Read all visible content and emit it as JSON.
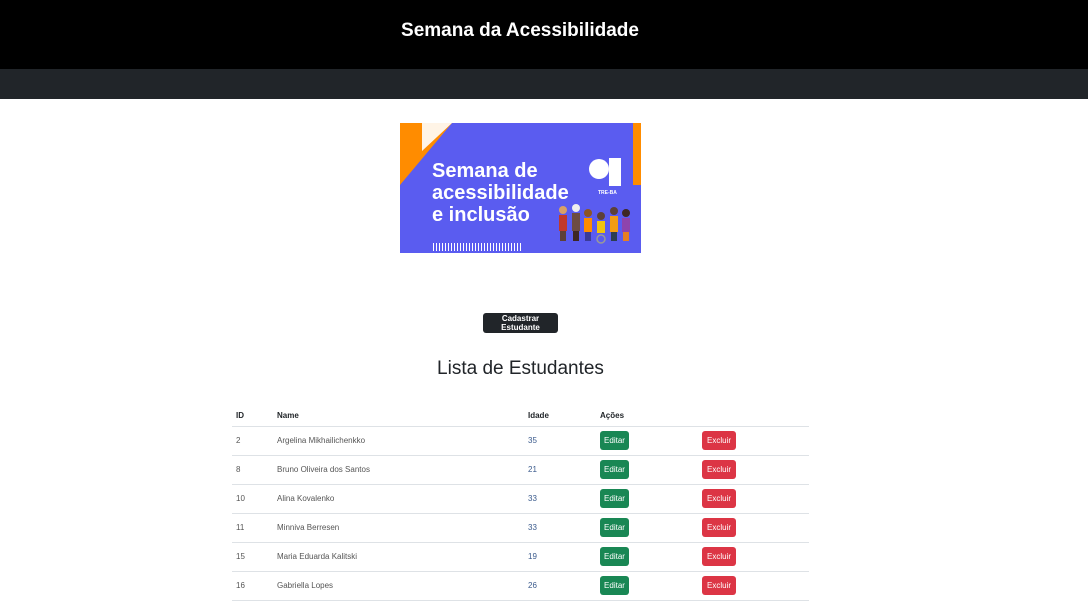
{
  "header": {
    "title": "Semana da Acessibilidade"
  },
  "banner": {
    "line1": "Semana de",
    "line2": "acessibilidade",
    "line3": "e inclusão",
    "logo_text": "TRE-BA",
    "colors": {
      "bg": "#5a5cf0",
      "accent": "#ff8c00"
    }
  },
  "actions": {
    "register_label": "Cadastrar Estudante"
  },
  "list": {
    "title": "Lista de Estudantes",
    "columns": {
      "id": "ID",
      "name": "Name",
      "age": "Idade",
      "actions": "Ações"
    },
    "edit_label": "Editar",
    "delete_label": "Excluir",
    "rows": [
      {
        "id": "2",
        "name": "Argelina Mikhailichenkko",
        "age": "35"
      },
      {
        "id": "8",
        "name": "Bruno Oliveira dos Santos",
        "age": "21"
      },
      {
        "id": "10",
        "name": "Alina Kovalenko",
        "age": "33"
      },
      {
        "id": "11",
        "name": "Minniva Berresen",
        "age": "33"
      },
      {
        "id": "15",
        "name": "Maria Eduarda Kalitski",
        "age": "19"
      },
      {
        "id": "16",
        "name": "Gabriella Lopes",
        "age": "26"
      }
    ]
  }
}
